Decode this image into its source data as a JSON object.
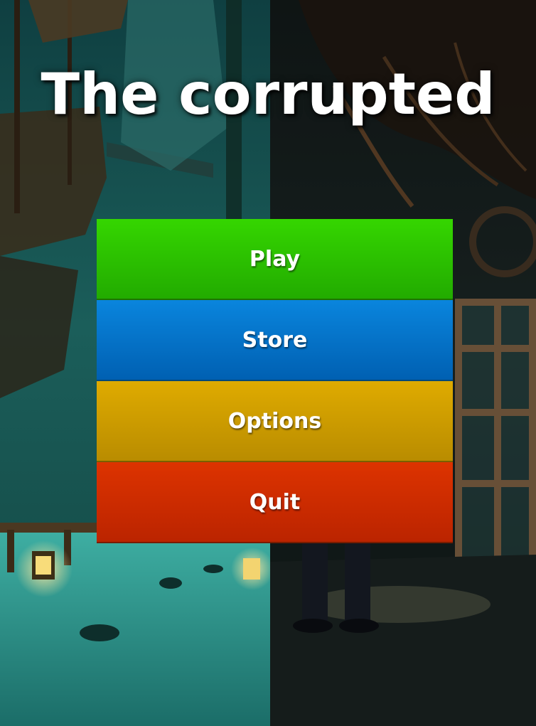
{
  "game": {
    "title": "The corrupted"
  },
  "menu": {
    "buttons": [
      {
        "label": "Play",
        "color": "#2ec200"
      },
      {
        "label": "Store",
        "color": "#0474cc"
      },
      {
        "label": "Options",
        "color": "#cd9b00"
      },
      {
        "label": "Quit",
        "color": "#cc2c00"
      }
    ]
  },
  "scene": {
    "left_tone": "#1e6a66",
    "right_tone": "#0f1c1c"
  }
}
